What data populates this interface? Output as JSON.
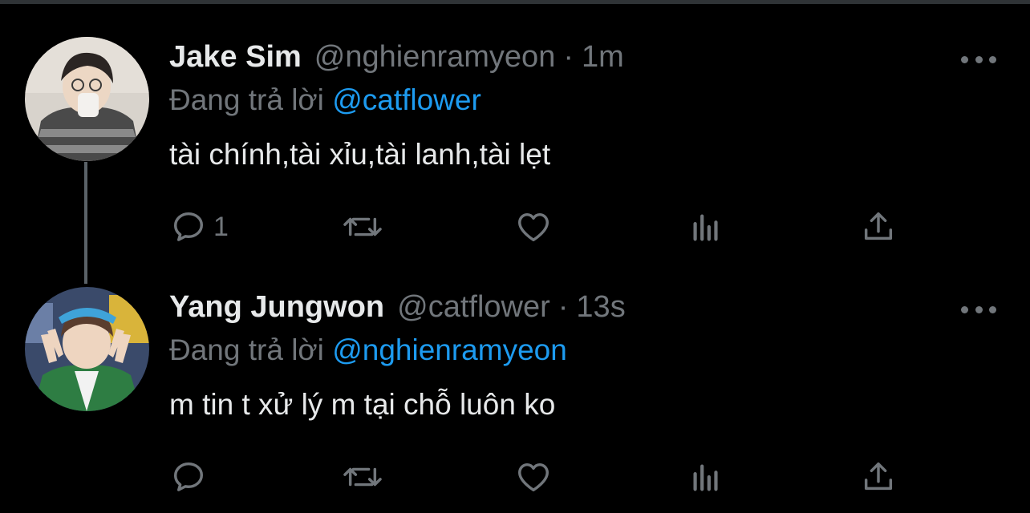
{
  "tweets": [
    {
      "name": "Jake Sim",
      "handle": "@nghienramyeon",
      "separator": "·",
      "time": "1m",
      "reply_prefix": "Đang trả lời",
      "reply_to": "@catflower",
      "text": "tài chính,tài xỉu,tài lanh,tài lẹt",
      "reply_count": "1",
      "icons": [
        "reply-icon",
        "retweet-icon",
        "like-icon",
        "views-icon",
        "share-icon",
        "more-icon"
      ]
    },
    {
      "name": "Yang Jungwon",
      "handle": "@catflower",
      "separator": "·",
      "time": "13s",
      "reply_prefix": "Đang trả lời",
      "reply_to": "@nghienramyeon",
      "text": "m tin t xử lý m tại chỗ luôn ko",
      "reply_count": "",
      "icons": [
        "reply-icon",
        "retweet-icon",
        "like-icon",
        "views-icon",
        "share-icon",
        "more-icon"
      ]
    }
  ],
  "colors": {
    "background": "#000000",
    "primary_text": "#e7e9ea",
    "secondary_text": "#71767b",
    "link": "#1d9bf0",
    "thread_line": "#5b6268"
  }
}
